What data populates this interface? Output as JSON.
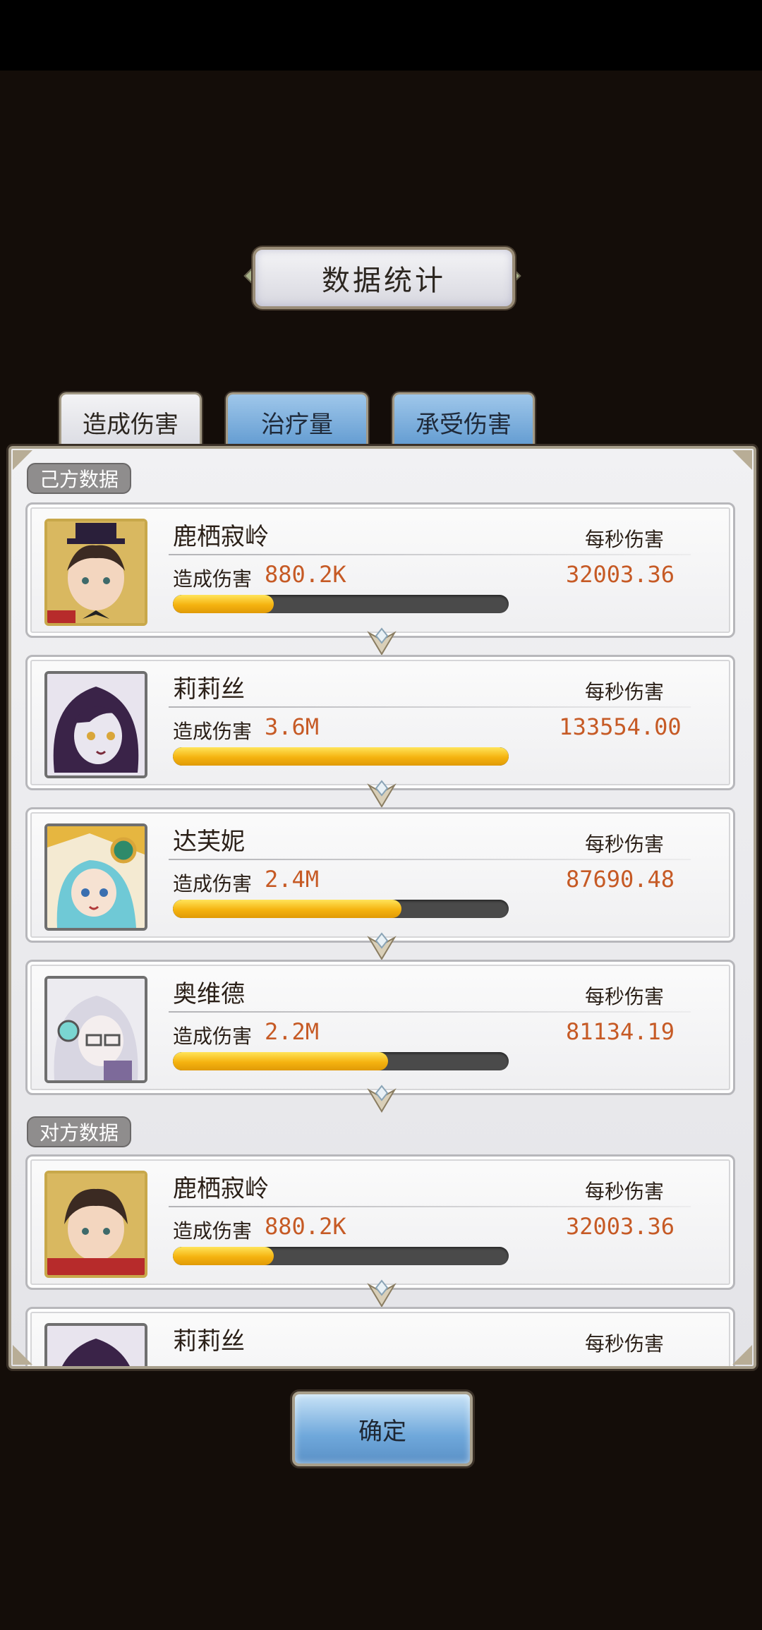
{
  "title": "数据统计",
  "tabs": [
    {
      "label": "造成伤害",
      "active": true
    },
    {
      "label": "治疗量",
      "active": false
    },
    {
      "label": "承受伤害",
      "active": false
    }
  ],
  "sections": {
    "own_label": "己方数据",
    "enemy_label": "对方数据"
  },
  "own": [
    {
      "name": "鹿栖寂岭",
      "dmg_label": "造成伤害",
      "dmg": "880.2K",
      "dps_label": "每秒伤害",
      "dps": "32003.36",
      "fill": 0.3
    },
    {
      "name": "莉莉丝",
      "dmg_label": "造成伤害",
      "dmg": "3.6M",
      "dps_label": "每秒伤害",
      "dps": "133554.00",
      "fill": 1.0
    },
    {
      "name": "达芙妮",
      "dmg_label": "造成伤害",
      "dmg": "2.4M",
      "dps_label": "每秒伤害",
      "dps": "87690.48",
      "fill": 0.68
    },
    {
      "name": "奥维德",
      "dmg_label": "造成伤害",
      "dmg": "2.2M",
      "dps_label": "每秒伤害",
      "dps": "81134.19",
      "fill": 0.64
    }
  ],
  "enemy": [
    {
      "name": "鹿栖寂岭",
      "dmg_label": "造成伤害",
      "dmg": "880.2K",
      "dps_label": "每秒伤害",
      "dps": "32003.36",
      "fill": 0.3
    },
    {
      "name": "莉莉丝",
      "dps_label": "每秒伤害"
    }
  ],
  "confirm_label": "确定",
  "colors": {
    "accent": "#c65a25",
    "bar": "#f5b310"
  }
}
